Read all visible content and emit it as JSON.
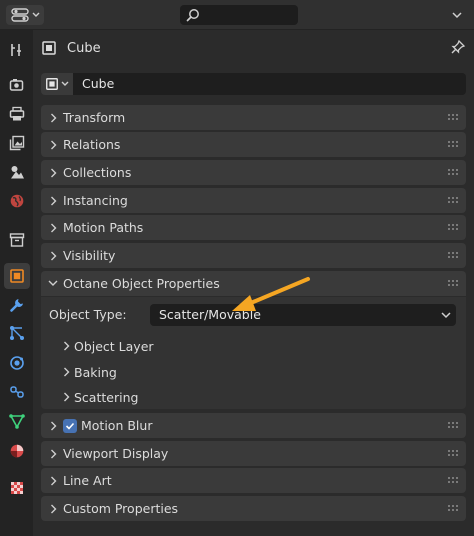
{
  "header": {
    "editor_icon": "properties-editor-icon",
    "search_icon": "search-icon",
    "options_icon": "chevron-down-icon"
  },
  "tabs": [
    {
      "name": "tool-tab",
      "icon": "tool-icon"
    },
    {
      "name": "render-tab",
      "icon": "render-icon"
    },
    {
      "name": "output-tab",
      "icon": "printer-icon"
    },
    {
      "name": "view-layer-tab",
      "icon": "image-icon"
    },
    {
      "name": "scene-tab",
      "icon": "scene-icon"
    },
    {
      "name": "world-tab",
      "icon": "world-icon"
    },
    {
      "name": "collection-tab",
      "icon": "collection-box-icon"
    },
    {
      "name": "object-tab",
      "icon": "object-icon",
      "active": true
    },
    {
      "name": "modifier-tab",
      "icon": "wrench-icon"
    },
    {
      "name": "particles-tab",
      "icon": "particles-icon"
    },
    {
      "name": "physics-tab",
      "icon": "physics-icon"
    },
    {
      "name": "constraints-tab",
      "icon": "constraints-icon"
    },
    {
      "name": "data-tab",
      "icon": "mesh-data-icon"
    },
    {
      "name": "material-tab",
      "icon": "material-icon"
    },
    {
      "name": "texture-tab",
      "icon": "checker-icon"
    }
  ],
  "object": {
    "title": "Cube",
    "name_value": "Cube"
  },
  "panels": {
    "transform": "Transform",
    "relations": "Relations",
    "collections": "Collections",
    "instancing": "Instancing",
    "motion_paths": "Motion Paths",
    "visibility": "Visibility",
    "octane": "Octane Object Properties",
    "motion_blur": "Motion Blur",
    "viewport_display": "Viewport Display",
    "line_art": "Line Art",
    "custom_properties": "Custom Properties"
  },
  "octane": {
    "object_type_label": "Object Type:",
    "object_type_value": "Scatter/Movable",
    "sub_object_layer": "Object Layer",
    "sub_baking": "Baking",
    "sub_scattering": "Scattering"
  },
  "motion_blur_checked": true,
  "colors": {
    "accent_blue": "#4772b3",
    "arrow_orange": "#f5a623",
    "object_orange": "#f08a24"
  }
}
